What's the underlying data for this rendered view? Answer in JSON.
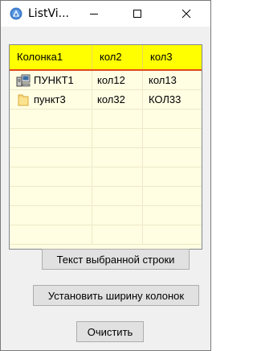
{
  "window": {
    "title": "ListVi...",
    "icon": "app-logo-icon"
  },
  "listview": {
    "columns": [
      "Колонка1",
      "кол2",
      "кол3"
    ],
    "rows": [
      {
        "icon": "computer-icon",
        "c1": "ПУНКТ1",
        "c2": "кол12",
        "c3": "кол13"
      },
      {
        "icon": "folder-icon",
        "c1": "пункт3",
        "c2": "кол32",
        "c3": "КОЛ33"
      }
    ],
    "header_color": "#ffff00",
    "background_color": "#fffde2"
  },
  "buttons": {
    "selected_text": "Текст выбранной строки",
    "set_width": "Установить ширину колонок",
    "clear": "Очистить"
  }
}
